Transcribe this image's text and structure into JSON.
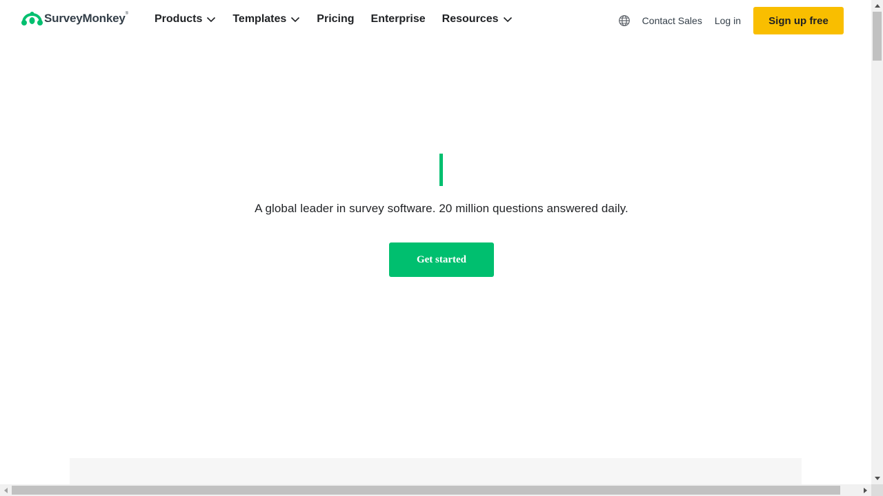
{
  "header": {
    "logo": {
      "text": "SurveyMonkey",
      "registered": "®",
      "icon": "surveymonkey-logo-icon",
      "color": "#00bf6f"
    },
    "nav": [
      {
        "label": "Products",
        "has_dropdown": true
      },
      {
        "label": "Templates",
        "has_dropdown": true
      },
      {
        "label": "Pricing",
        "has_dropdown": false
      },
      {
        "label": "Enterprise",
        "has_dropdown": false
      },
      {
        "label": "Resources",
        "has_dropdown": true
      }
    ],
    "language_icon": "globe-icon",
    "contact_sales": "Contact Sales",
    "log_in": "Log in",
    "sign_up": "Sign up free",
    "sign_up_color": "#f9be00"
  },
  "hero": {
    "typing_cursor_color": "#00bf6f",
    "tagline": "A global leader in survey software. 20 million questions answered daily.",
    "cta_label": "Get started",
    "cta_color": "#00bf6f"
  },
  "scrollbars": {
    "vertical": true,
    "horizontal": true
  }
}
